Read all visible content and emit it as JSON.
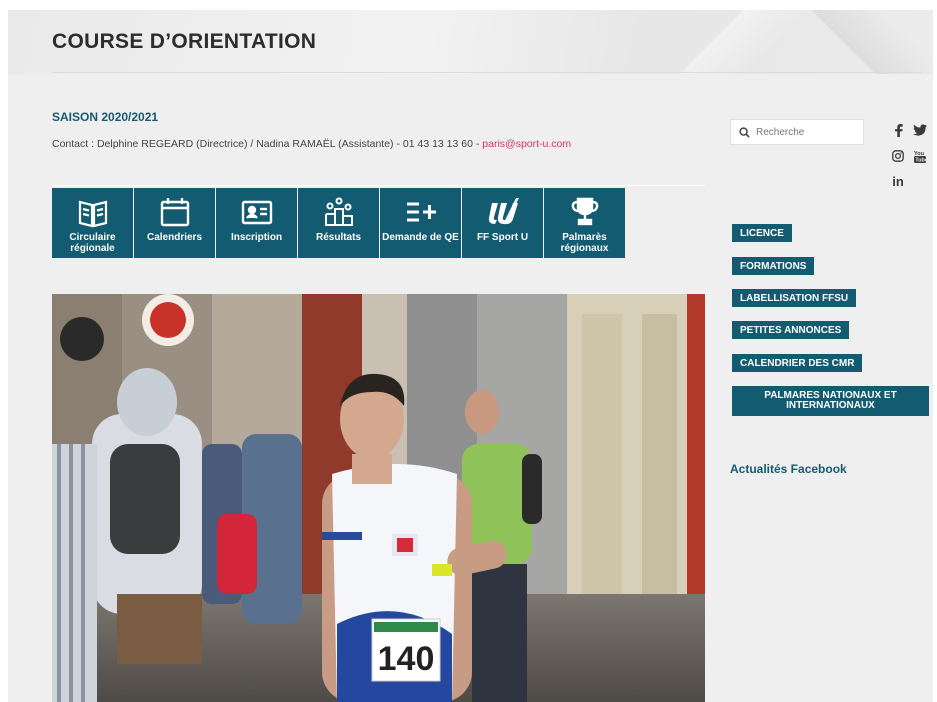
{
  "header": {
    "title": "COURSE D’ORIENTATION"
  },
  "season": {
    "title": "SAISON 2020/2021"
  },
  "contact": {
    "text": "Contact : Delphine REGEARD (Directrice) / Nadina RAMAËL (Assistante) - 01 43 13 13 60 - ",
    "email": "paris@sport-u.com"
  },
  "tiles": [
    {
      "label": "Circulaire régionale",
      "icon": "book-icon"
    },
    {
      "label": "Calendriers",
      "icon": "calendar-icon"
    },
    {
      "label": "Inscription",
      "icon": "id-card-icon"
    },
    {
      "label": "Résultats",
      "icon": "podium-icon"
    },
    {
      "label": "Demande de QE",
      "icon": "list-plus-icon"
    },
    {
      "label": "FF Sport U",
      "icon": "ffsu-logo-icon"
    },
    {
      "label": "Palmarès régionaux",
      "icon": "trophy-icon"
    }
  ],
  "hero": {
    "bib_number": "140",
    "icon": "runner-photo"
  },
  "search": {
    "placeholder": "Recherche",
    "icon": "search-icon"
  },
  "social": [
    {
      "icon": "facebook-icon",
      "glyph": "f"
    },
    {
      "icon": "twitter-icon",
      "glyph": "🐦"
    },
    {
      "icon": "instagram-icon",
      "glyph": "◎"
    },
    {
      "icon": "youtube-icon",
      "glyph": "You"
    },
    {
      "icon": "linkedin-icon",
      "glyph": "in"
    }
  ],
  "sidebar": {
    "buttons": [
      "LICENCE",
      "FORMATIONS",
      "LABELLISATION FFSU",
      "PETITES ANNONCES",
      "CALENDRIER DES CMR",
      "PALMARES NATIONAUX ET INTERNATIONAUX"
    ],
    "facebook_title": "Actualités Facebook"
  },
  "colors": {
    "brand": "#125b71",
    "accent": "#d6336c",
    "background": "#efefef"
  }
}
